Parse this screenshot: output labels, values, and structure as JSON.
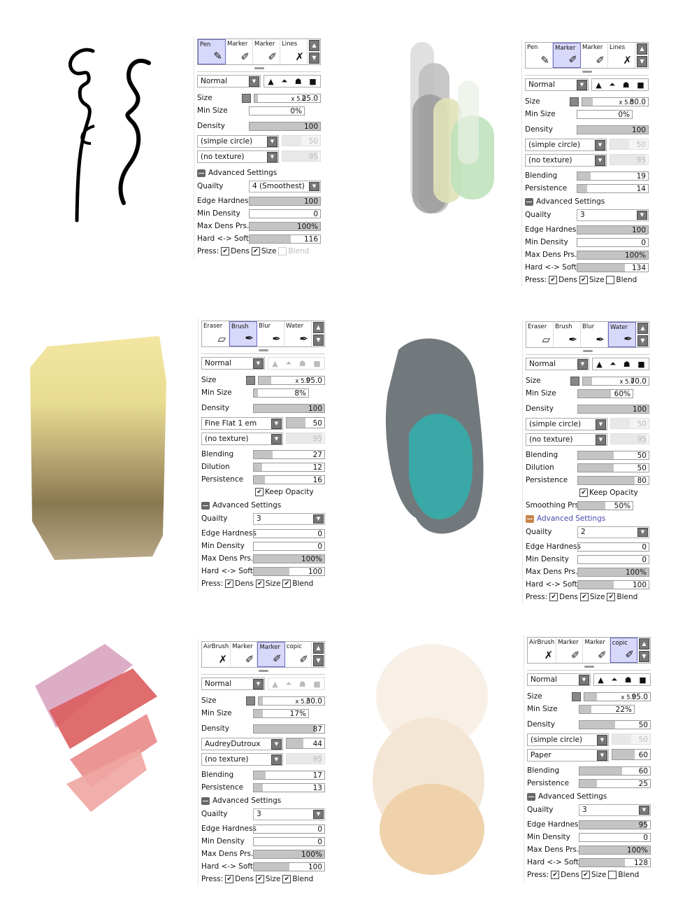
{
  "panels": [
    {
      "tabs": [
        {
          "label": "Pen",
          "icon": "pen"
        },
        {
          "label": "Marker",
          "icon": "marker"
        },
        {
          "label": "Marker",
          "icon": "marker"
        },
        {
          "label": "Lines",
          "icon": "lines"
        }
      ],
      "active": 0,
      "blend_mode": "Normal",
      "shapes_enabled": true,
      "rows": [
        {
          "t": "size",
          "label": "Size",
          "mult": "x 5.0",
          "value": "25.0"
        },
        {
          "t": "slider",
          "label": "Min Size",
          "value": "0%",
          "level": 0
        },
        {
          "t": "slider",
          "label": "Density",
          "value": "100",
          "level": 1,
          "gap": true
        },
        {
          "t": "sel",
          "name": "(simple circle)",
          "value": "50",
          "level": 0.5,
          "enabled": false
        },
        {
          "t": "sel",
          "name": "(no texture)",
          "value": "95",
          "level": 0.95,
          "enabled": false
        },
        {
          "t": "sec",
          "label": "Advanced Settings"
        },
        {
          "t": "select",
          "label": "Quailty",
          "value": "4 (Smoothest)"
        },
        {
          "t": "slider",
          "label": "Edge Hardness",
          "value": "100",
          "level": 1
        },
        {
          "t": "slider",
          "label": "Min Density",
          "value": "0",
          "level": 0
        },
        {
          "t": "slider",
          "label": "Max Dens Prs.",
          "value": "100%",
          "level": 1
        },
        {
          "t": "slider",
          "label": "Hard <-> Soft",
          "value": "116",
          "level": 0.58
        },
        {
          "t": "press",
          "label": "Press:",
          "dens": true,
          "size": true,
          "blend": false,
          "blend_enabled": false,
          "dens_label": "Dens",
          "size_label": "Size",
          "blend_label": "Blend"
        }
      ]
    },
    {
      "tabs": [
        {
          "label": "Pen",
          "icon": "pen"
        },
        {
          "label": "Marker",
          "icon": "marker"
        },
        {
          "label": "Marker",
          "icon": "marker"
        },
        {
          "label": "Lines",
          "icon": "lines"
        }
      ],
      "active": 1,
      "blend_mode": "Normal",
      "shapes_enabled": true,
      "rows": [
        {
          "t": "size",
          "label": "Size",
          "mult": "x 5.0",
          "value": "80.0"
        },
        {
          "t": "slider",
          "label": "Min Size",
          "value": "0%",
          "level": 0
        },
        {
          "t": "slider",
          "label": "Density",
          "value": "100",
          "level": 1,
          "gap": true
        },
        {
          "t": "sel",
          "name": "(simple circle)",
          "value": "50",
          "level": 0.5,
          "enabled": false
        },
        {
          "t": "sel",
          "name": "(no texture)",
          "value": "95",
          "level": 0.95,
          "enabled": false
        },
        {
          "t": "slider",
          "label": "Blending",
          "value": "19",
          "level": 0.19
        },
        {
          "t": "slider",
          "label": "Persistence",
          "value": "14",
          "level": 0.14
        },
        {
          "t": "sec",
          "label": "Advanced Settings"
        },
        {
          "t": "select",
          "label": "Quailty",
          "value": "3"
        },
        {
          "t": "slider",
          "label": "Edge Hardness",
          "value": "100",
          "level": 1
        },
        {
          "t": "slider",
          "label": "Min Density",
          "value": "0",
          "level": 0
        },
        {
          "t": "slider",
          "label": "Max Dens Prs.",
          "value": "100%",
          "level": 1
        },
        {
          "t": "slider",
          "label": "Hard <-> Soft",
          "value": "134",
          "level": 0.67
        },
        {
          "t": "press",
          "label": "Press:",
          "dens": true,
          "size": true,
          "blend": false,
          "blend_enabled": true,
          "dens_label": "Dens",
          "size_label": "Size",
          "blend_label": "Blend"
        }
      ]
    },
    {
      "tabs": [
        {
          "label": "Eraser",
          "icon": "eraser"
        },
        {
          "label": "Brush",
          "icon": "brush"
        },
        {
          "label": "Blur",
          "icon": "blur"
        },
        {
          "label": "Water",
          "icon": "water"
        }
      ],
      "active": 1,
      "blend_mode": "Normal",
      "shapes_enabled": false,
      "rows": [
        {
          "t": "size",
          "label": "Size",
          "mult": "x 5.0",
          "value": "95.0"
        },
        {
          "t": "slider",
          "label": "Min Size",
          "value": "8%",
          "level": 0.08
        },
        {
          "t": "slider",
          "label": "Density",
          "value": "100",
          "level": 1,
          "gap": true
        },
        {
          "t": "sel",
          "name": "Fine Flat 1 em",
          "value": "50",
          "level": 0.5,
          "enabled": true
        },
        {
          "t": "sel",
          "name": "(no texture)",
          "value": "95",
          "level": 0.95,
          "enabled": false
        },
        {
          "t": "slider",
          "label": "Blending",
          "value": "27",
          "level": 0.27
        },
        {
          "t": "slider",
          "label": "Dilution",
          "value": "12",
          "level": 0.12
        },
        {
          "t": "slider",
          "label": "Persistence",
          "value": "16",
          "level": 0.16
        },
        {
          "t": "check",
          "label": "Keep Opacity",
          "checked": true
        },
        {
          "t": "sec",
          "label": "Advanced Settings"
        },
        {
          "t": "select",
          "label": "Quailty",
          "value": "3"
        },
        {
          "t": "slider",
          "label": "Edge Hardness",
          "value": "0",
          "level": 0
        },
        {
          "t": "slider",
          "label": "Min Density",
          "value": "0",
          "level": 0
        },
        {
          "t": "slider",
          "label": "Max Dens Prs.",
          "value": "100%",
          "level": 1
        },
        {
          "t": "slider",
          "label": "Hard <-> Soft",
          "value": "100",
          "level": 0.5
        },
        {
          "t": "press",
          "label": "Press:",
          "dens": true,
          "size": true,
          "blend": true,
          "blend_enabled": true,
          "dens_label": "Dens",
          "size_label": "Size",
          "blend_label": "Blend"
        }
      ]
    },
    {
      "tabs": [
        {
          "label": "Eraser",
          "icon": "eraser"
        },
        {
          "label": "Brush",
          "icon": "brush"
        },
        {
          "label": "Blur",
          "icon": "blur"
        },
        {
          "label": "Water",
          "icon": "water"
        }
      ],
      "active": 3,
      "blend_mode": "Normal",
      "shapes_enabled": true,
      "rows": [
        {
          "t": "size",
          "label": "Size",
          "mult": "x 5.0",
          "value": "70.0"
        },
        {
          "t": "slider",
          "label": "Min Size",
          "value": "60%",
          "level": 0.6
        },
        {
          "t": "slider",
          "label": "Density",
          "value": "100",
          "level": 1,
          "gap": true
        },
        {
          "t": "sel",
          "name": "(simple circle)",
          "value": "50",
          "level": 0.5,
          "enabled": false
        },
        {
          "t": "sel",
          "name": "(no texture)",
          "value": "95",
          "level": 0.95,
          "enabled": false
        },
        {
          "t": "slider",
          "label": "Blending",
          "value": "50",
          "level": 0.5
        },
        {
          "t": "slider",
          "label": "Dilution",
          "value": "50",
          "level": 0.5
        },
        {
          "t": "slider",
          "label": "Persistence",
          "value": "80",
          "level": 0.8
        },
        {
          "t": "check",
          "label": "Keep Opacity",
          "checked": true
        },
        {
          "t": "slider",
          "label": "Smoothing Prs",
          "value": "50%",
          "level": 0.5
        },
        {
          "t": "sec",
          "label": "Advanced Settings",
          "highlight": true
        },
        {
          "t": "select",
          "label": "Quailty",
          "value": "2"
        },
        {
          "t": "slider",
          "label": "Edge Hardness",
          "value": "0",
          "level": 0
        },
        {
          "t": "slider",
          "label": "Min Density",
          "value": "0",
          "level": 0
        },
        {
          "t": "slider",
          "label": "Max Dens Prs.",
          "value": "100%",
          "level": 1
        },
        {
          "t": "slider",
          "label": "Hard <-> Soft",
          "value": "100",
          "level": 0.5
        },
        {
          "t": "press",
          "label": "Press:",
          "dens": true,
          "size": true,
          "blend": true,
          "blend_enabled": true,
          "dens_label": "Dens",
          "size_label": "Size",
          "blend_label": "Blend"
        }
      ]
    },
    {
      "tabs": [
        {
          "label": "AirBrush",
          "icon": "airbrush"
        },
        {
          "label": "Marker",
          "icon": "marker"
        },
        {
          "label": "Marker",
          "icon": "marker"
        },
        {
          "label": "copic",
          "icon": "marker"
        }
      ],
      "active": 2,
      "blend_mode": "Normal",
      "shapes_enabled": false,
      "rows": [
        {
          "t": "size",
          "label": "Size",
          "mult": "x 5.0",
          "value": "30.0"
        },
        {
          "t": "slider",
          "label": "Min Size",
          "value": "17%",
          "level": 0.17
        },
        {
          "t": "slider",
          "label": "Density",
          "value": "87",
          "level": 0.87,
          "gap": true
        },
        {
          "t": "sel",
          "name": "AudreyDutroux",
          "value": "44",
          "level": 0.44,
          "enabled": true
        },
        {
          "t": "sel",
          "name": "(no texture)",
          "value": "95",
          "level": 0.95,
          "enabled": false
        },
        {
          "t": "slider",
          "label": "Blending",
          "value": "17",
          "level": 0.17
        },
        {
          "t": "slider",
          "label": "Persistence",
          "value": "13",
          "level": 0.13
        },
        {
          "t": "sec",
          "label": "Advanced Settings"
        },
        {
          "t": "select",
          "label": "Quailty",
          "value": "3"
        },
        {
          "t": "slider",
          "label": "Edge Hardness",
          "value": "0",
          "level": 0
        },
        {
          "t": "slider",
          "label": "Min Density",
          "value": "0",
          "level": 0
        },
        {
          "t": "slider",
          "label": "Max Dens Prs.",
          "value": "100%",
          "level": 1
        },
        {
          "t": "slider",
          "label": "Hard <-> Soft",
          "value": "100",
          "level": 0.5
        },
        {
          "t": "press",
          "label": "Press:",
          "dens": true,
          "size": true,
          "blend": true,
          "blend_enabled": true,
          "dens_label": "Dens",
          "size_label": "Size",
          "blend_label": "Blend"
        }
      ]
    },
    {
      "tabs": [
        {
          "label": "AirBrush",
          "icon": "airbrush"
        },
        {
          "label": "Marker",
          "icon": "marker"
        },
        {
          "label": "Marker",
          "icon": "marker"
        },
        {
          "label": "copic",
          "icon": "marker"
        }
      ],
      "active": 3,
      "blend_mode": "Normal",
      "shapes_enabled": true,
      "rows": [
        {
          "t": "size",
          "label": "Size",
          "mult": "x 5.0",
          "value": "95.0"
        },
        {
          "t": "slider",
          "label": "Min Size",
          "value": "22%",
          "level": 0.22
        },
        {
          "t": "slider",
          "label": "Density",
          "value": "50",
          "level": 0.5,
          "gap": true
        },
        {
          "t": "sel",
          "name": "(simple circle)",
          "value": "50",
          "level": 0.5,
          "enabled": false
        },
        {
          "t": "sel",
          "name": "Paper",
          "value": "60",
          "level": 0.6,
          "enabled": true
        },
        {
          "t": "slider",
          "label": "Blending",
          "value": "60",
          "level": 0.6
        },
        {
          "t": "slider",
          "label": "Persistence",
          "value": "25",
          "level": 0.25
        },
        {
          "t": "sec",
          "label": "Advanced Settings"
        },
        {
          "t": "select",
          "label": "Quailty",
          "value": "3"
        },
        {
          "t": "slider",
          "label": "Edge Hardness",
          "value": "95",
          "level": 0.95
        },
        {
          "t": "slider",
          "label": "Min Density",
          "value": "0",
          "level": 0
        },
        {
          "t": "slider",
          "label": "Max Dens Prs.",
          "value": "100%",
          "level": 1
        },
        {
          "t": "slider",
          "label": "Hard <-> Soft",
          "value": "128",
          "level": 0.64
        },
        {
          "t": "press",
          "label": "Press:",
          "dens": true,
          "size": true,
          "blend": false,
          "blend_enabled": true,
          "dens_label": "Dens",
          "size_label": "Size",
          "blend_label": "Blend"
        }
      ]
    }
  ],
  "colors": {
    "active_tab": "#d8d8fa",
    "slider_fill": "#c4c4c4",
    "advanced_highlight": "#c8824a",
    "advanced_link": "#4a4ab0"
  }
}
